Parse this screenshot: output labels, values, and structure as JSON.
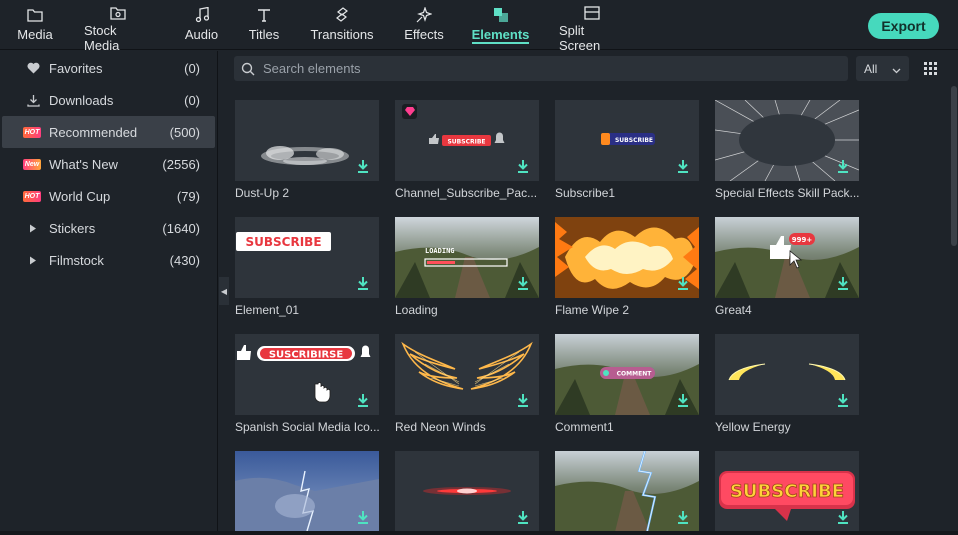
{
  "tabs": [
    {
      "label": "Media",
      "icon": "folder-icon"
    },
    {
      "label": "Stock Media",
      "icon": "stock-media-icon"
    },
    {
      "label": "Audio",
      "icon": "music-note-icon"
    },
    {
      "label": "Titles",
      "icon": "text-t-icon"
    },
    {
      "label": "Transitions",
      "icon": "transitions-icon"
    },
    {
      "label": "Effects",
      "icon": "effects-sparkle-icon"
    },
    {
      "label": "Elements",
      "icon": "elements-layers-icon",
      "active": true
    },
    {
      "label": "Split Screen",
      "icon": "split-screen-icon"
    }
  ],
  "export_label": "Export",
  "sidebar": {
    "items": [
      {
        "label": "Favorites",
        "count": "(0)",
        "icon": "heart-icon"
      },
      {
        "label": "Downloads",
        "count": "(0)",
        "icon": "download-tray-icon"
      },
      {
        "label": "Recommended",
        "count": "(500)",
        "badge": "HOT",
        "active": true
      },
      {
        "label": "What's New",
        "count": "(2556)",
        "badge": "New"
      },
      {
        "label": "World Cup",
        "count": "(79)",
        "badge": "HOT"
      },
      {
        "label": "Stickers",
        "count": "(1640)",
        "icon": "expand-triangle-icon"
      },
      {
        "label": "Filmstock",
        "count": "(430)",
        "icon": "expand-triangle-icon"
      }
    ]
  },
  "search": {
    "placeholder": "Search elements"
  },
  "filter": {
    "selected": "All"
  },
  "elements": [
    {
      "label": "Dust-Up 2"
    },
    {
      "label": "Channel_Subscribe_Pac..."
    },
    {
      "label": "Subscribe1"
    },
    {
      "label": "Special Effects Skill Pack..."
    },
    {
      "label": "Element_01"
    },
    {
      "label": "Loading"
    },
    {
      "label": "Flame Wipe 2"
    },
    {
      "label": "Great4"
    },
    {
      "label": "Spanish Social Media Ico..."
    },
    {
      "label": "Red Neon Winds"
    },
    {
      "label": "Comment1"
    },
    {
      "label": "Yellow Energy"
    },
    {
      "label": ""
    },
    {
      "label": ""
    },
    {
      "label": ""
    },
    {
      "label": ""
    }
  ],
  "thumb_text": {
    "subscribe": "SUBSCRIBE",
    "subscribe_small": "SUBSCRIBE",
    "suscribirse": "SUSCRIBIRSE",
    "loading": "LOADING",
    "count_badge": "999+",
    "comment": "COMMENT"
  },
  "colors": {
    "accent": "#46d9bd",
    "sidebar_active": "#3a4048",
    "download": "#4fe3c1"
  }
}
